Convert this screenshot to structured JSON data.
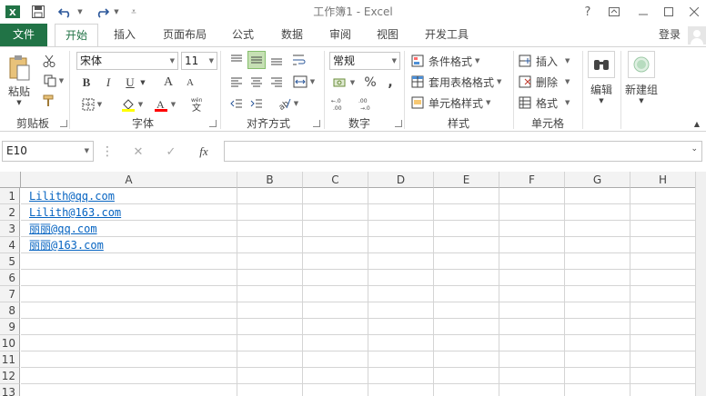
{
  "window": {
    "title": "工作簿1 - Excel",
    "login": "登录"
  },
  "tabs": [
    {
      "label": "文件"
    },
    {
      "label": "开始"
    },
    {
      "label": "插入"
    },
    {
      "label": "页面布局"
    },
    {
      "label": "公式"
    },
    {
      "label": "数据"
    },
    {
      "label": "审阅"
    },
    {
      "label": "视图"
    },
    {
      "label": "开发工具"
    }
  ],
  "ribbon": {
    "clipboard": {
      "paste": "粘贴",
      "label": "剪贴板"
    },
    "font": {
      "name": "宋体",
      "size": "11",
      "bold": "B",
      "italic": "I",
      "underline": "U",
      "grow": "A",
      "shrink": "A",
      "label": "字体"
    },
    "alignment": {
      "label": "对齐方式"
    },
    "number": {
      "format": "常规",
      "percent": "%",
      "comma": ",",
      "label": "数字"
    },
    "styles": {
      "conditional": "条件格式",
      "table": "套用表格格式",
      "cell": "单元格样式",
      "label": "样式"
    },
    "cells": {
      "insert": "插入",
      "delete": "删除",
      "format": "格式",
      "label": "单元格"
    },
    "editing": {
      "label": "编辑"
    },
    "newgroup": {
      "label": "新建组"
    }
  },
  "formula_bar": {
    "name_box": "E10",
    "cancel": "✕",
    "enter": "✓",
    "fx": "fx",
    "value": ""
  },
  "sheet": {
    "columns": [
      "A",
      "B",
      "C",
      "D",
      "E",
      "F",
      "G",
      "H"
    ],
    "rows": [
      "1",
      "2",
      "3",
      "4",
      "5",
      "6",
      "7",
      "8",
      "9",
      "10",
      "11",
      "12",
      "13"
    ],
    "cells": [
      {
        "ref": "A1",
        "text": "Lilith@qq.com"
      },
      {
        "ref": "A2",
        "text": "Lilith@163.com"
      },
      {
        "ref": "A3",
        "text": "丽丽@qq.com"
      },
      {
        "ref": "A4",
        "text": "丽丽@163.com"
      }
    ],
    "link_color": "#0563c1"
  },
  "colors": {
    "accent": "#217346"
  }
}
